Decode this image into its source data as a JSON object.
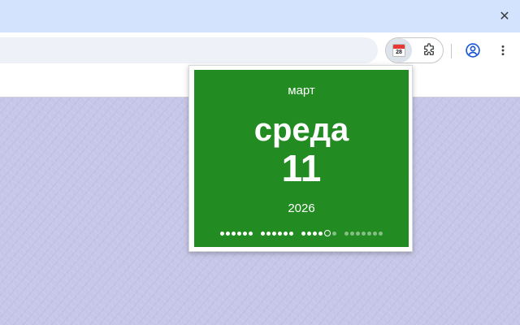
{
  "browser": {
    "close_symbol": "✕",
    "extension_icon_day": "28",
    "icons": {
      "close": "close-icon",
      "calendar": "calendar-icon",
      "extensions": "puzzle-icon",
      "profile": "account-circle-icon",
      "menu": "more-vert-icon"
    }
  },
  "calendar": {
    "month": "март",
    "weekday": "среда",
    "day": "11",
    "year": "2026",
    "card_color": "#228b22",
    "weeks_dots": [
      {
        "days": 6,
        "today_index": -1,
        "future_from": -1
      },
      {
        "days": 6,
        "today_index": -1,
        "future_from": -1
      },
      {
        "days": 6,
        "today_index": 4,
        "future_from": 5
      },
      {
        "days": 7,
        "today_index": -1,
        "future_from": 0
      }
    ]
  }
}
